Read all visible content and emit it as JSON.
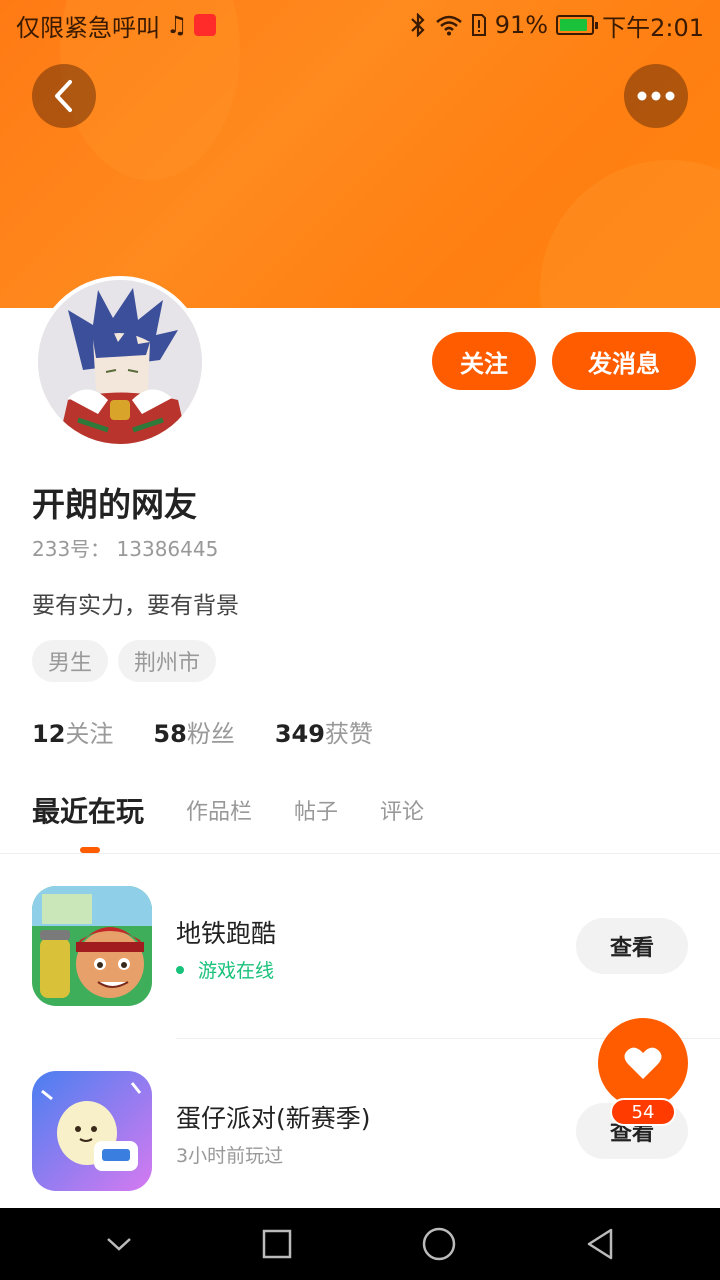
{
  "status_bar": {
    "carrier_text": "仅限紧急呼叫",
    "battery_percent": "91%",
    "time": "下午2:01",
    "icons": [
      "music-icon",
      "app-badge-icon",
      "bluetooth-icon",
      "wifi-icon",
      "sim-alert-icon",
      "battery-icon"
    ]
  },
  "header": {
    "back_icon": "chevron-left-icon",
    "more_icon": "more-dots-icon"
  },
  "profile": {
    "follow_label": "关注",
    "message_label": "发消息",
    "name": "开朗的网友",
    "id_line": "233号： 13386445",
    "bio": "要有实力，要有背景",
    "tags": [
      "男生",
      "荆州市"
    ],
    "stats": [
      {
        "num": "12",
        "label": "关注"
      },
      {
        "num": "58",
        "label": "粉丝"
      },
      {
        "num": "349",
        "label": "获赞"
      }
    ]
  },
  "tabs": [
    {
      "label": "最近在玩",
      "active": true
    },
    {
      "label": "作品栏",
      "active": false
    },
    {
      "label": "帖子",
      "active": false
    },
    {
      "label": "评论",
      "active": false
    }
  ],
  "games": [
    {
      "title": "地铁跑酷",
      "subtitle": "游戏在线",
      "online": true,
      "action": "查看"
    },
    {
      "title": "蛋仔派对(新赛季)",
      "subtitle": "3小时前玩过",
      "online": false,
      "action": "查看"
    }
  ],
  "fab": {
    "icon": "heart-icon",
    "count": "54"
  },
  "colors": {
    "accent": "#ff5c00",
    "header": "#ff7f12",
    "online_green": "#19c27a"
  }
}
